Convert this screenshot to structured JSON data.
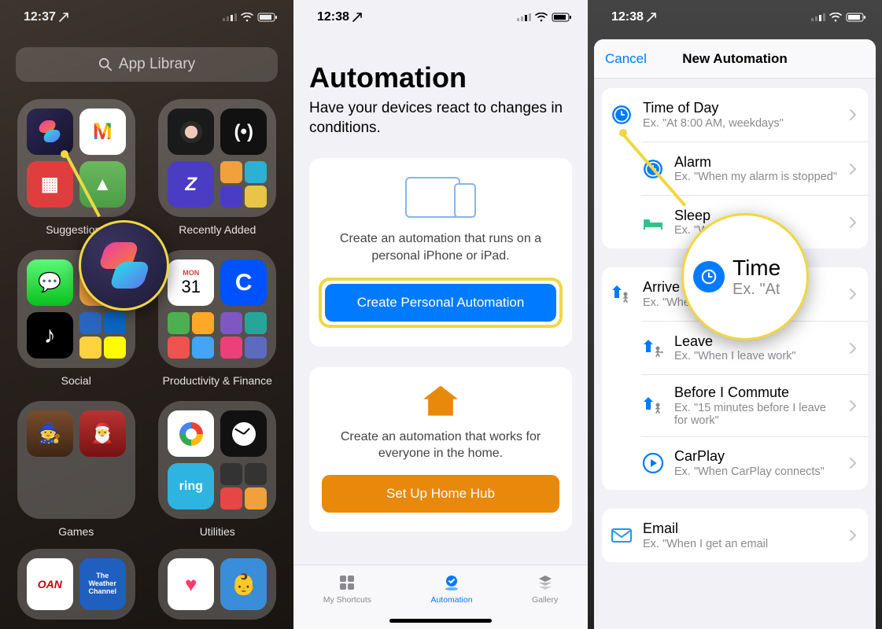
{
  "phone1": {
    "time": "12:37",
    "search_placeholder": "App Library",
    "folders": [
      {
        "label": "Suggestions"
      },
      {
        "label": "Recently Added"
      },
      {
        "label": "Social"
      },
      {
        "label": "Productivity & Finance"
      },
      {
        "label": "Games"
      },
      {
        "label": "Utilities"
      }
    ],
    "callout_app": "Shortcuts"
  },
  "phone2": {
    "time": "12:38",
    "heading": "Automation",
    "subtitle": "Have your devices react to changes in conditions.",
    "personal_desc": "Create an automation that runs on a personal iPhone or iPad.",
    "personal_btn": "Create Personal Automation",
    "home_desc": "Create an automation that works for everyone in the home.",
    "home_btn": "Set Up Home Hub",
    "tabs": {
      "shortcuts": "My Shortcuts",
      "automation": "Automation",
      "gallery": "Gallery"
    }
  },
  "phone3": {
    "time": "12:38",
    "cancel": "Cancel",
    "title": "New Automation",
    "zoom": {
      "title": "Time",
      "sub": "Ex. \"At"
    },
    "groups": [
      [
        {
          "icon": "clock",
          "color": "#007aff",
          "title": "Time of Day",
          "sub": "Ex. \"At 8:00 AM, weekdays\""
        },
        {
          "icon": "clock",
          "color": "#007aff",
          "title": "Alarm",
          "sub": "Ex. \"When my alarm is stopped\""
        },
        {
          "icon": "bed",
          "color": "#2fc28a",
          "title": "Sleep",
          "sub": "Ex. \"When  's\""
        }
      ],
      [
        {
          "icon": "arrive",
          "color": "#007aff",
          "title": "Arrive",
          "sub": "Ex. \"When I arrive at the gym\""
        },
        {
          "icon": "leave",
          "color": "#007aff",
          "title": "Leave",
          "sub": "Ex. \"When I leave work\""
        },
        {
          "icon": "commute",
          "color": "#007aff",
          "title": "Before I Commute",
          "sub": "Ex. \"15 minutes before I leave for work\""
        },
        {
          "icon": "carplay",
          "color": "#007aff",
          "title": "CarPlay",
          "sub": "Ex. \"When CarPlay connects\""
        }
      ],
      [
        {
          "icon": "mail",
          "color": "#2196f3",
          "title": "Email",
          "sub": "Ex. \"When I get an email"
        }
      ]
    ]
  }
}
